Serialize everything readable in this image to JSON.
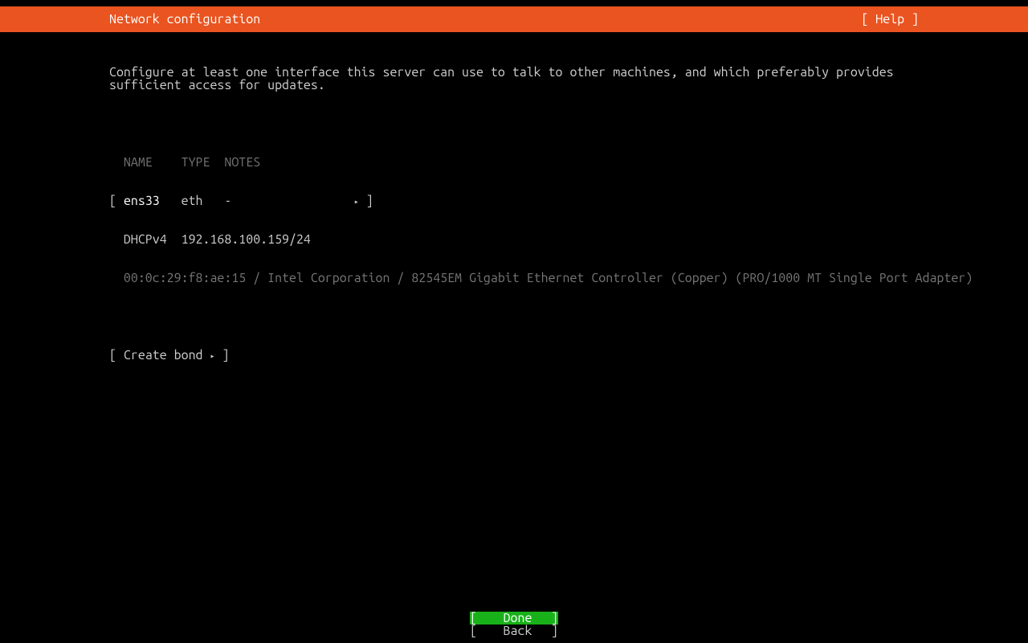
{
  "header": {
    "title": "Network configuration",
    "help_label": "[ Help ]"
  },
  "instruction": "Configure at least one interface this server can use to talk to other machines, and which preferably provides sufficient access for updates.",
  "table": {
    "headers": {
      "name": "NAME",
      "type": "TYPE",
      "notes": "NOTES"
    },
    "iface": {
      "name": "ens33",
      "type": "eth",
      "notes": "-",
      "arrow": "▸",
      "dhcp_label": "DHCPv4",
      "dhcp_value": "192.168.100.159/24",
      "info": "00:0c:29:f8:ae:15 / Intel Corporation / 82545EM Gigabit Ethernet Controller (Copper) (PRO/1000 MT Single Port Adapter)"
    }
  },
  "actions": {
    "create_bond": "Create bond",
    "create_bond_arrow": "▸"
  },
  "footer": {
    "done": "Done",
    "back": "Back"
  },
  "brackets": {
    "open": "[",
    "close": "]"
  }
}
